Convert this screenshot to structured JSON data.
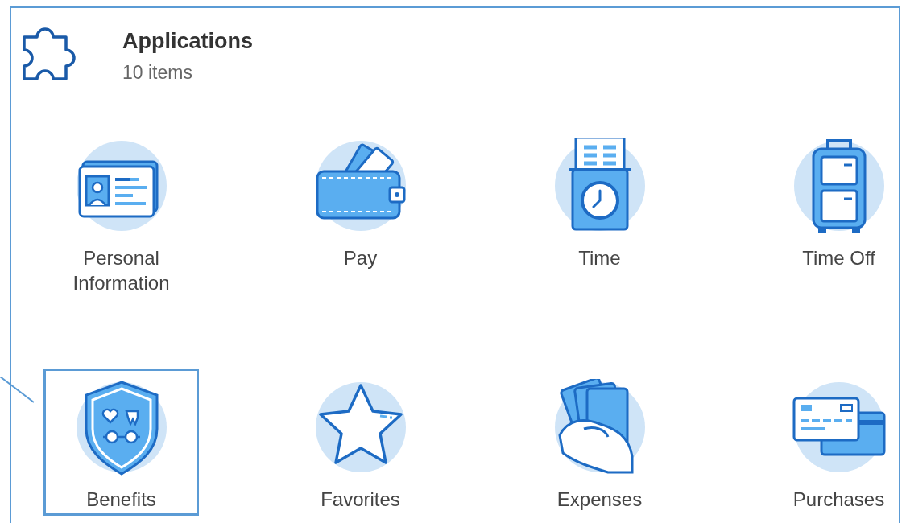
{
  "header": {
    "title": "Applications",
    "count": "10 items"
  },
  "apps": [
    {
      "label": "Personal Information",
      "selected": false
    },
    {
      "label": "Pay",
      "selected": false
    },
    {
      "label": "Time",
      "selected": false
    },
    {
      "label": "Time Off",
      "selected": false
    },
    {
      "label": "Benefits",
      "selected": true
    },
    {
      "label": "Favorites",
      "selected": false
    },
    {
      "label": "Expenses",
      "selected": false
    },
    {
      "label": "Purchases",
      "selected": false
    }
  ]
}
